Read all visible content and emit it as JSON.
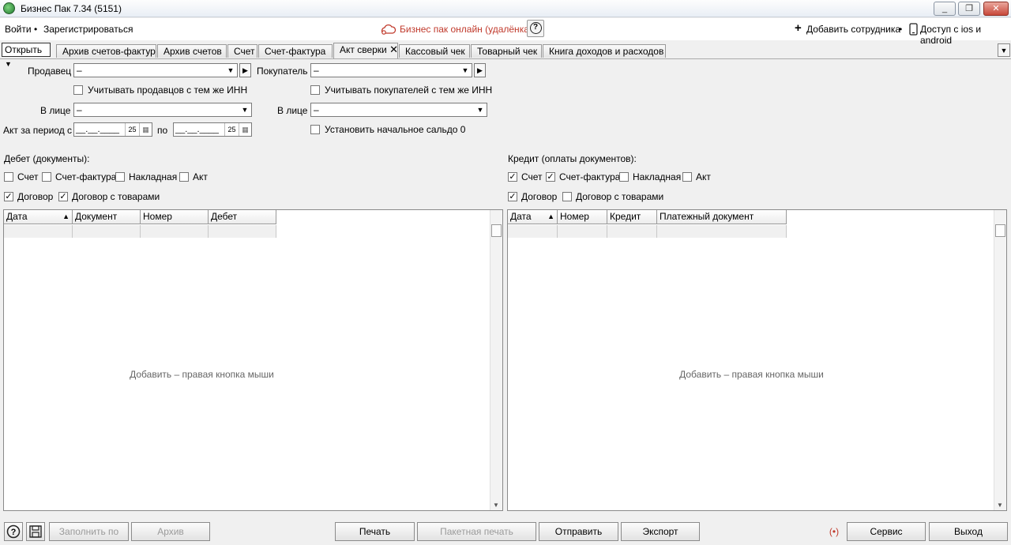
{
  "window": {
    "title": "Бизнес Пак 7.34 (5151)",
    "controls": [
      "_",
      "❐",
      "✕"
    ]
  },
  "menu": {
    "login": "Войти",
    "separator": "•",
    "register": "Зарегистрироваться",
    "online": "Бизнес пак онлайн (удалёнка)",
    "add_employee": "Добавить сотрудника",
    "mobile_access": "Доступ с ios и android"
  },
  "toolbar": {
    "open": "Открыть"
  },
  "tabs": [
    {
      "label": "Архив счетов-фактур"
    },
    {
      "label": "Архив счетов"
    },
    {
      "label": "Счет"
    },
    {
      "label": "Счет-фактура"
    },
    {
      "label": "Акт сверки",
      "active": true
    },
    {
      "label": "Кассовый чек"
    },
    {
      "label": "Товарный чек"
    },
    {
      "label": "Книга доходов и расходов"
    }
  ],
  "form": {
    "seller_label": "Продавец",
    "seller_value": "–",
    "buyer_label": "Покупатель",
    "buyer_value": "–",
    "seller_inn_check": "Учитывать продавцов с тем же ИНН",
    "buyer_inn_check": "Учитывать покупателей с тем же ИНН",
    "in_person_label": "В лице",
    "seller_person_value": "–",
    "buyer_person_value": "–",
    "period_label": "Акт за период с",
    "period_to_label": "по",
    "date_from": "__.__.____",
    "date_to": "__.__.____",
    "date_num": "25",
    "zero_balance": "Установить начальное сальдо 0"
  },
  "debit": {
    "title": "Дебет (документы):",
    "checks": [
      {
        "label": "Счет",
        "checked": false
      },
      {
        "label": "Счет-фактура",
        "checked": false
      },
      {
        "label": "Накладная",
        "checked": false
      },
      {
        "label": "Акт",
        "checked": false
      },
      {
        "label": "Договор",
        "checked": true
      },
      {
        "label": "Договор с товарами",
        "checked": true
      }
    ],
    "columns": [
      "Дата",
      "Документ",
      "Номер",
      "Дебет"
    ],
    "sort_indicator": "▲",
    "hint": "Добавить – правая кнопка мыши"
  },
  "credit": {
    "title": "Кредит (оплаты документов):",
    "checks": [
      {
        "label": "Счет",
        "checked": true
      },
      {
        "label": "Счет-фактура",
        "checked": true
      },
      {
        "label": "Накладная",
        "checked": false
      },
      {
        "label": "Акт",
        "checked": false
      },
      {
        "label": "Договор",
        "checked": true
      },
      {
        "label": "Договор с товарами",
        "checked": false
      }
    ],
    "columns": [
      "Дата",
      "Номер",
      "Кредит",
      "Платежный документ"
    ],
    "sort_indicator": "▲",
    "hint": "Добавить – правая кнопка мыши"
  },
  "bottom": {
    "fill": "Заполнить по",
    "archive": "Архив",
    "print": "Печать",
    "batch_print": "Пакетная печать",
    "send": "Отправить",
    "export": "Экспорт",
    "service": "Сервис",
    "exit": "Выход"
  },
  "icons": [
    "app-icon",
    "cloud-link-icon",
    "help-icon",
    "plus-icon",
    "phone-icon",
    "dropdown-arrow-icon",
    "go-arrow-icon",
    "calendar-icon",
    "save-icon",
    "broadcast-icon"
  ]
}
